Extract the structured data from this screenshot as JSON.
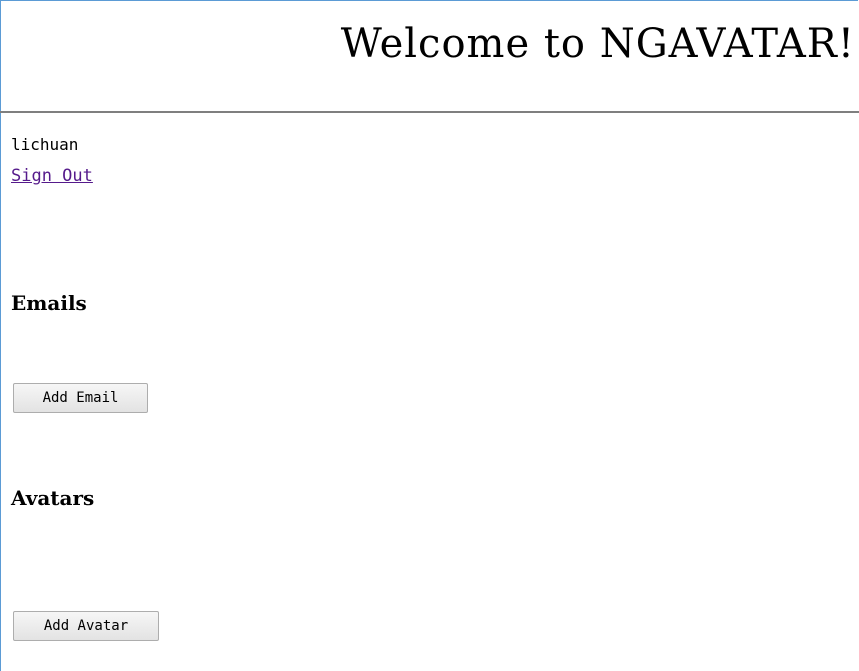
{
  "header": {
    "title": "Welcome to NGAVATAR!"
  },
  "user": {
    "username": "lichuan",
    "sign_out_label": "Sign Out"
  },
  "emails": {
    "heading": "Emails",
    "add_label": "Add Email"
  },
  "avatars": {
    "heading": "Avatars",
    "add_label": "Add Avatar"
  },
  "colors": {
    "link_visited": "#551a8b",
    "frame_border": "#5b9bd5",
    "rule": "#7f7f7f"
  }
}
